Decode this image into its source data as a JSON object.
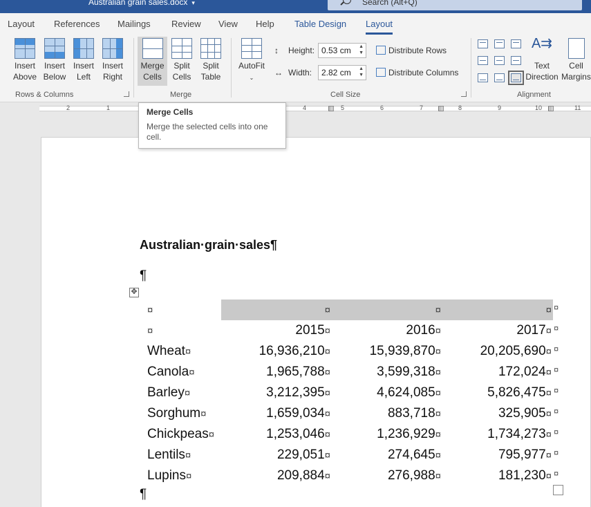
{
  "title_bar": {
    "document_title": "Australian grain sales.docx",
    "search_placeholder": "Search (Alt+Q)"
  },
  "ribbon": {
    "tabs": [
      {
        "label": "Layout"
      },
      {
        "label": "References"
      },
      {
        "label": "Mailings"
      },
      {
        "label": "Review"
      },
      {
        "label": "View"
      },
      {
        "label": "Help"
      },
      {
        "label": "Table Design"
      },
      {
        "label": "Layout"
      }
    ],
    "active_tab": "Layout",
    "rows_columns": {
      "group_label": "Rows & Columns",
      "insert_above": [
        "Insert",
        "Above"
      ],
      "insert_below": [
        "Insert",
        "Below"
      ],
      "insert_left": [
        "Insert",
        "Left"
      ],
      "insert_right": [
        "Insert",
        "Right"
      ]
    },
    "merge": {
      "group_label": "Merge",
      "merge_cells": [
        "Merge",
        "Cells"
      ],
      "split_cells": [
        "Split",
        "Cells"
      ],
      "split_table": [
        "Split",
        "Table"
      ]
    },
    "autofit_label": "AutoFit",
    "cell_size": {
      "group_label": "Cell Size",
      "height_label": "Height:",
      "height_value": "0.53 cm",
      "width_label": "Width:",
      "width_value": "2.82 cm",
      "distribute_rows": "Distribute Rows",
      "distribute_columns": "Distribute Columns"
    },
    "alignment": {
      "group_label": "Alignment",
      "text_direction": [
        "Text",
        "Direction"
      ],
      "cell_margins": [
        "Cell",
        "Margins"
      ]
    },
    "accent_color": "#2b579a"
  },
  "ruler": {
    "numbers": [
      "2",
      "1",
      "1",
      "4",
      "5",
      "6",
      "7",
      "8",
      "9",
      "10",
      "11"
    ]
  },
  "tooltip": {
    "title": "Merge Cells",
    "body": "Merge the selected cells into one cell."
  },
  "document": {
    "heading": "Australian·grain·sales¶",
    "pilcrow": "¶",
    "cell_marker": "¤",
    "table": {
      "header_row": [
        "",
        "",
        "",
        ""
      ],
      "year_row": [
        "",
        "2015",
        "2016",
        "2017"
      ],
      "rows": [
        {
          "crop": "Wheat",
          "values": [
            "16,936,210",
            "15,939,870",
            "20,205,690"
          ]
        },
        {
          "crop": "Canola",
          "values": [
            "1,965,788",
            "3,599,318",
            "172,024"
          ]
        },
        {
          "crop": "Barley",
          "values": [
            "3,212,395",
            "4,624,085",
            "5,826,475"
          ]
        },
        {
          "crop": "Sorghum",
          "values": [
            "1,659,034",
            "883,718",
            "325,905"
          ]
        },
        {
          "crop": "Chickpeas",
          "values": [
            "1,253,046",
            "1,236,929",
            "1,734,273"
          ]
        },
        {
          "crop": "Lentils",
          "values": [
            "229,051",
            "274,645",
            "795,977"
          ]
        },
        {
          "crop": "Lupins",
          "values": [
            "209,884",
            "276,988",
            "181,230"
          ]
        }
      ]
    }
  }
}
